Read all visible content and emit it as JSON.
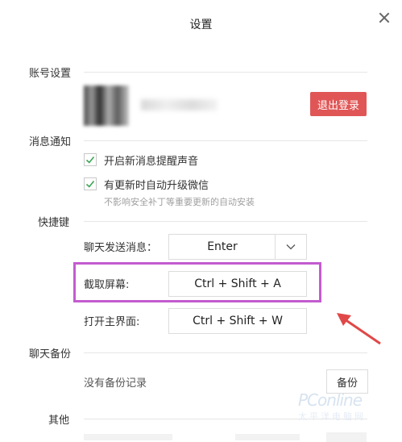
{
  "window": {
    "title": "设置"
  },
  "sections": {
    "account": "账号设置",
    "notifications": "消息通知",
    "shortcuts": "快捷键",
    "backup": "聊天备份",
    "other": "其他"
  },
  "account": {
    "logout_label": "退出登录"
  },
  "notifications": {
    "sound_label": "开启新消息提醒声音",
    "sound_checked": true,
    "autoupdate_label": "有更新时自动升级微信",
    "autoupdate_checked": true,
    "autoupdate_hint": "不影响安全补丁等重要更新的自动安装"
  },
  "shortcuts": {
    "send_label": "聊天发送消息：",
    "send_value": "Enter",
    "capture_label": "截取屏幕:",
    "capture_value": "Ctrl + Shift + A",
    "open_label": "打开主界面:",
    "open_value": "Ctrl + Shift + W"
  },
  "backup": {
    "empty_text": "没有备份记录",
    "button_label": "备份"
  },
  "watermark": {
    "main": "PConline",
    "sub": "太平洋电脑网"
  },
  "colors": {
    "accent_red": "#e05656",
    "highlight": "#c35ccf",
    "arrow": "#e04848"
  }
}
